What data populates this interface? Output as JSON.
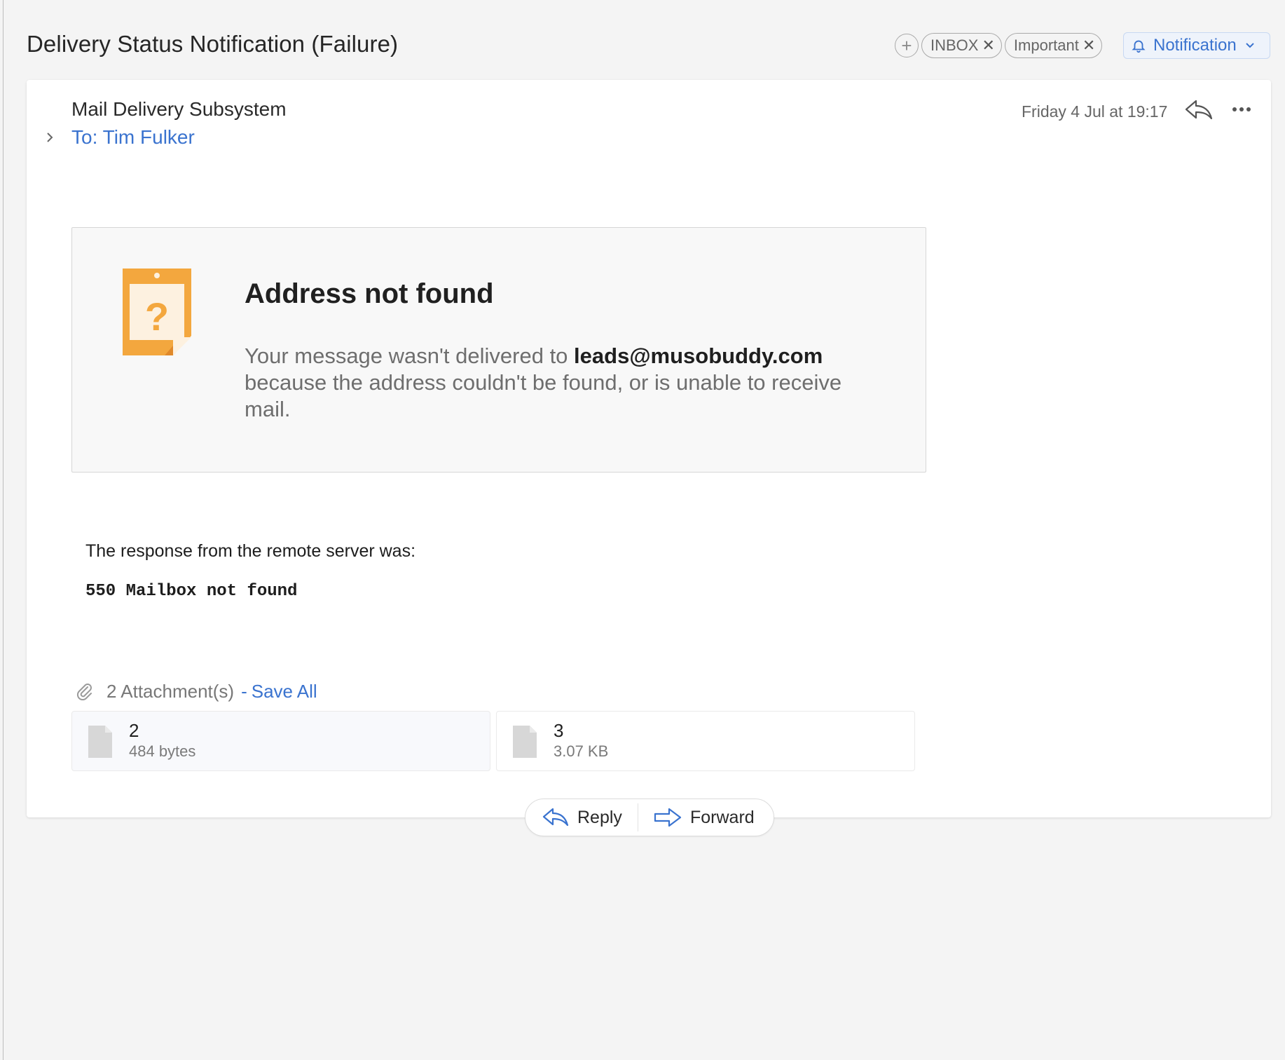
{
  "header": {
    "subject": "Delivery Status Notification (Failure)",
    "add_tag_symbol": "+",
    "tags": [
      {
        "label": "INBOX",
        "remove_symbol": "✕"
      },
      {
        "label": "Important",
        "remove_symbol": "✕"
      }
    ],
    "notification_label": "Notification"
  },
  "message": {
    "sender": "Mail Delivery Subsystem",
    "to": "To: Tim Fulker",
    "date": "Friday 4 Jul at 19:17",
    "notice": {
      "title": "Address not found",
      "body_prefix": "Your message wasn't delivered to ",
      "address": "leads@musobuddy.com",
      "body_suffix": " because the address couldn't be found, or is unable to receive mail."
    },
    "server_response_label": "The response from the remote server was:",
    "server_response_code": "550 Mailbox not found"
  },
  "attachments": {
    "count_label": "2 Attachment(s)",
    "separator": "-",
    "save_all_label": "Save All",
    "files": [
      {
        "name": "2",
        "size": "484 bytes"
      },
      {
        "name": "3",
        "size": "3.07 KB"
      }
    ]
  },
  "actions": {
    "reply_label": "Reply",
    "forward_label": "Forward"
  },
  "icons": {
    "accent_color": "#3a73cf",
    "sticky_color": "#f3a73e",
    "names": [
      "plus-icon",
      "close-icon",
      "bell-icon",
      "chevron-down-icon",
      "chevron-right-icon",
      "reply-icon",
      "more-icon",
      "question-note-icon",
      "paperclip-icon",
      "file-icon",
      "forward-icon"
    ]
  }
}
